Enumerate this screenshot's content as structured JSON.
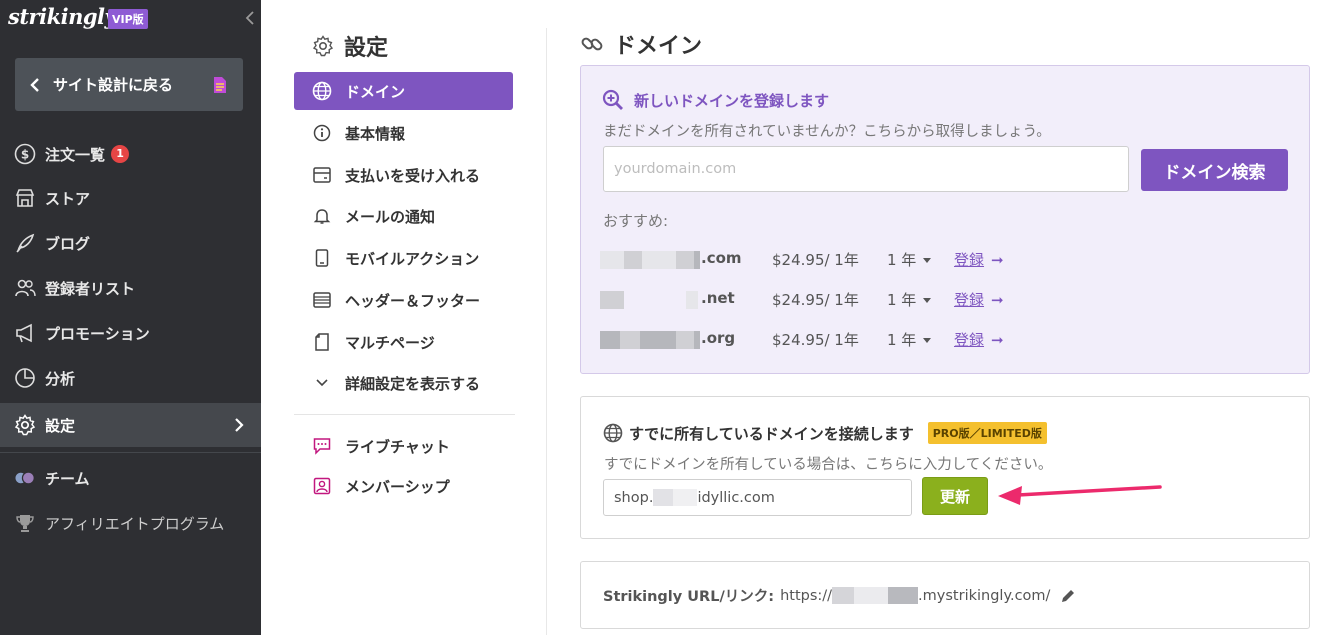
{
  "brand": {
    "logo_text": "strikingly",
    "vip_badge": "VIP版"
  },
  "sidebar": {
    "back_label": "サイト設計に戻る",
    "items": [
      {
        "label": "注文一覧",
        "icon": "dollar-circle-icon",
        "badge": "1"
      },
      {
        "label": "ストア",
        "icon": "store-icon"
      },
      {
        "label": "ブログ",
        "icon": "quill-icon"
      },
      {
        "label": "登録者リスト",
        "icon": "users-icon"
      },
      {
        "label": "プロモーション",
        "icon": "megaphone-icon"
      },
      {
        "label": "分析",
        "icon": "pie-chart-icon"
      },
      {
        "label": "設定",
        "icon": "gear-icon",
        "active": true
      },
      {
        "label": "チーム",
        "icon": "team-avatars-icon"
      },
      {
        "label": "アフィリエイトプログラム",
        "icon": "trophy-icon"
      }
    ]
  },
  "settings": {
    "title": "設定",
    "menu": [
      {
        "label": "ドメイン",
        "icon": "globe-icon",
        "active": true
      },
      {
        "label": "基本情報",
        "icon": "info-icon"
      },
      {
        "label": "支払いを受け入れる",
        "icon": "payment-icon"
      },
      {
        "label": "メールの通知",
        "icon": "bell-icon"
      },
      {
        "label": "モバイルアクション",
        "icon": "mobile-icon"
      },
      {
        "label": "ヘッダー＆フッター",
        "icon": "header-footer-icon"
      },
      {
        "label": "マルチページ",
        "icon": "pages-icon"
      },
      {
        "label": "詳細設定を表示する",
        "icon": "chevron-down-icon"
      }
    ],
    "extra": [
      {
        "label": "ライブチャット",
        "icon": "chat-icon"
      },
      {
        "label": "メンバーシップ",
        "icon": "member-icon"
      }
    ]
  },
  "domain_page": {
    "title": "ドメイン",
    "new_domain": {
      "heading": "新しいドメインを登録します",
      "subtitle": "まだドメインを所有されていませんか？こちらから取得しましょう。",
      "placeholder": "yourdomain.com",
      "search_button": "ドメイン検索",
      "recommend_label": "おすすめ:",
      "suggestions": [
        {
          "tld": ".com",
          "price": "$24.95/ 1年",
          "period": "1 年",
          "register": "登録"
        },
        {
          "tld": ".net",
          "price": "$24.95/ 1年",
          "period": "1 年",
          "register": "登録"
        },
        {
          "tld": ".org",
          "price": "$24.95/ 1年",
          "period": "1 年",
          "register": "登録"
        }
      ]
    },
    "connect": {
      "heading": "すでに所有しているドメインを接続します",
      "badge": "PRO版／LIMITED版",
      "subtitle": "すでにドメインを所有している場合は、こちらに入力してください。",
      "value_prefix": "shop.",
      "value_suffix": "idyllic.com",
      "update_button": "更新"
    },
    "strikingly_url": {
      "label": "Strikingly URL/リンク:",
      "prefix": "https://",
      "suffix": ".mystrikingly.com/"
    }
  },
  "colors": {
    "accent": "#7e55c0",
    "sidebar_bg": "#2e2f33",
    "update_green": "#8bb01d",
    "annotation_arrow": "#ec2a6c"
  }
}
